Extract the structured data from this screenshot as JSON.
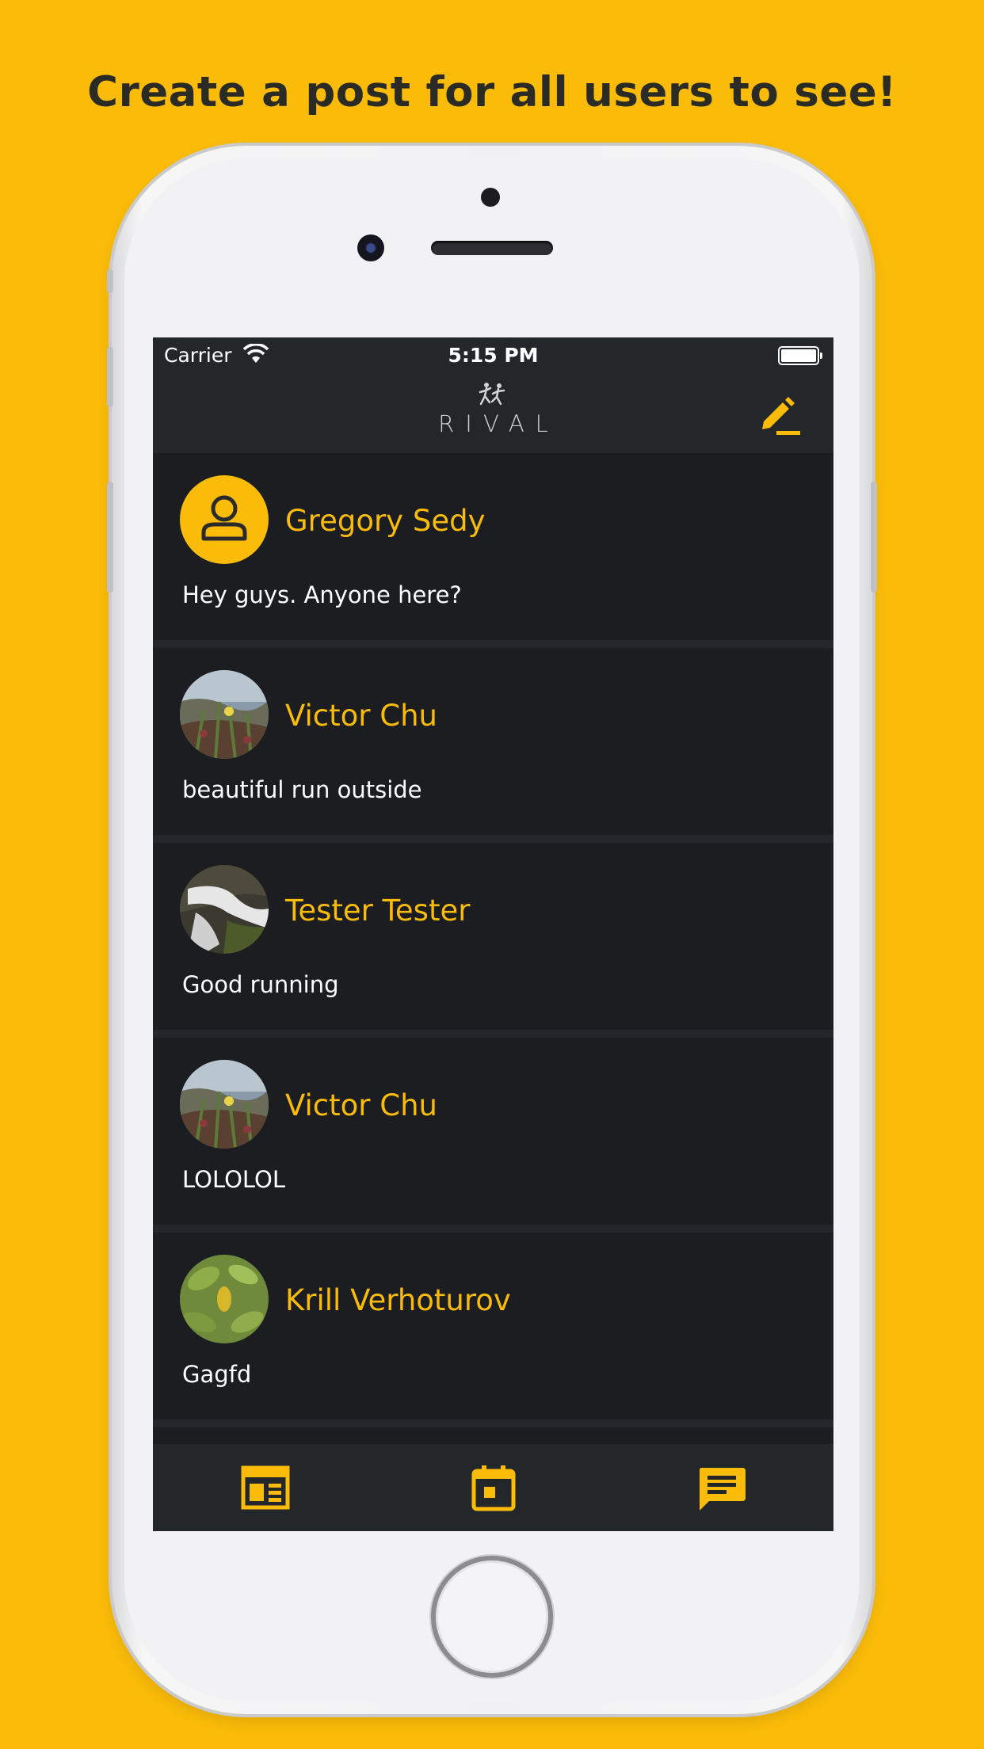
{
  "headline": "Create a post for all users to see!",
  "status_bar": {
    "carrier": "Carrier",
    "time": "5:15 PM",
    "wifi_icon": "wifi-icon",
    "battery_icon": "battery-icon"
  },
  "nav": {
    "logo_text": "RIVAL",
    "edit_icon": "pencil-icon"
  },
  "posts": [
    {
      "name": "Gregory Sedy",
      "text": "Hey guys. Anyone here?",
      "avatar": "default-user-icon"
    },
    {
      "name": "Victor Chu",
      "text": "beautiful run outside",
      "avatar": "photo-flowers"
    },
    {
      "name": "Tester Tester",
      "text": "Good running",
      "avatar": "photo-waterfall"
    },
    {
      "name": "Victor Chu",
      "text": "LOLOLOL",
      "avatar": "photo-flowers"
    },
    {
      "name": "Krill Verhoturov",
      "text": "Gagfd",
      "avatar": "photo-leaves"
    }
  ],
  "tabs": [
    {
      "icon": "newspaper-icon"
    },
    {
      "icon": "calendar-icon"
    },
    {
      "icon": "chat-icon",
      "active": true
    }
  ],
  "colors": {
    "accent": "#FABB09",
    "background": "#1B1D21",
    "bar": "#24272A"
  }
}
